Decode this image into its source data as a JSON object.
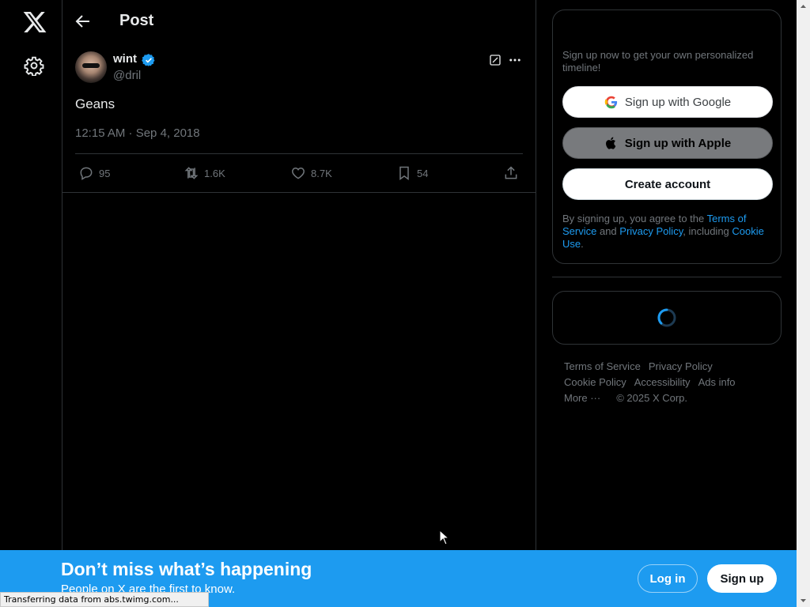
{
  "header": {
    "title": "Post"
  },
  "tweet": {
    "author_name": "wint",
    "handle": "@dril",
    "text": "Geans",
    "timestamp": "12:15 AM · Sep 4, 2018",
    "replies": "95",
    "reposts": "1.6K",
    "likes": "8.7K",
    "bookmarks": "54"
  },
  "signup": {
    "blurb": "Sign up now to get your own personalized timeline!",
    "google_label": "Sign up with Google",
    "apple_label": "Sign up with Apple",
    "create_label": "Create account",
    "legal": {
      "prefix": "By signing up, you agree to the ",
      "terms": "Terms of Service",
      "and": " and ",
      "privacy": "Privacy Policy",
      "including": ", including ",
      "cookie": "Cookie Use",
      "end": "."
    }
  },
  "footer": {
    "row1": [
      "Terms of Service",
      "Privacy Policy"
    ],
    "row2": [
      "Cookie Policy",
      "Accessibility",
      "Ads info"
    ],
    "more": "More ···",
    "copyright": "© 2025 X Corp."
  },
  "bottom_bar": {
    "title": "Don’t miss what’s happening",
    "subtitle": "People on X are the first to know.",
    "login": "Log in",
    "signup": "Sign up"
  },
  "status_bar": {
    "text": "Transferring data from abs.twimg.com..."
  },
  "colors": {
    "accent": "#1d9bf0",
    "background": "#000000",
    "muted": "#71767b",
    "border": "#2f3336"
  },
  "icons": [
    "x-logo-icon",
    "gear-icon",
    "back-arrow-icon",
    "verified-badge-icon",
    "grok-icon",
    "more-icon",
    "reply-icon",
    "repost-icon",
    "like-icon",
    "bookmark-icon",
    "share-icon",
    "google-icon",
    "apple-icon",
    "spinner-icon"
  ]
}
